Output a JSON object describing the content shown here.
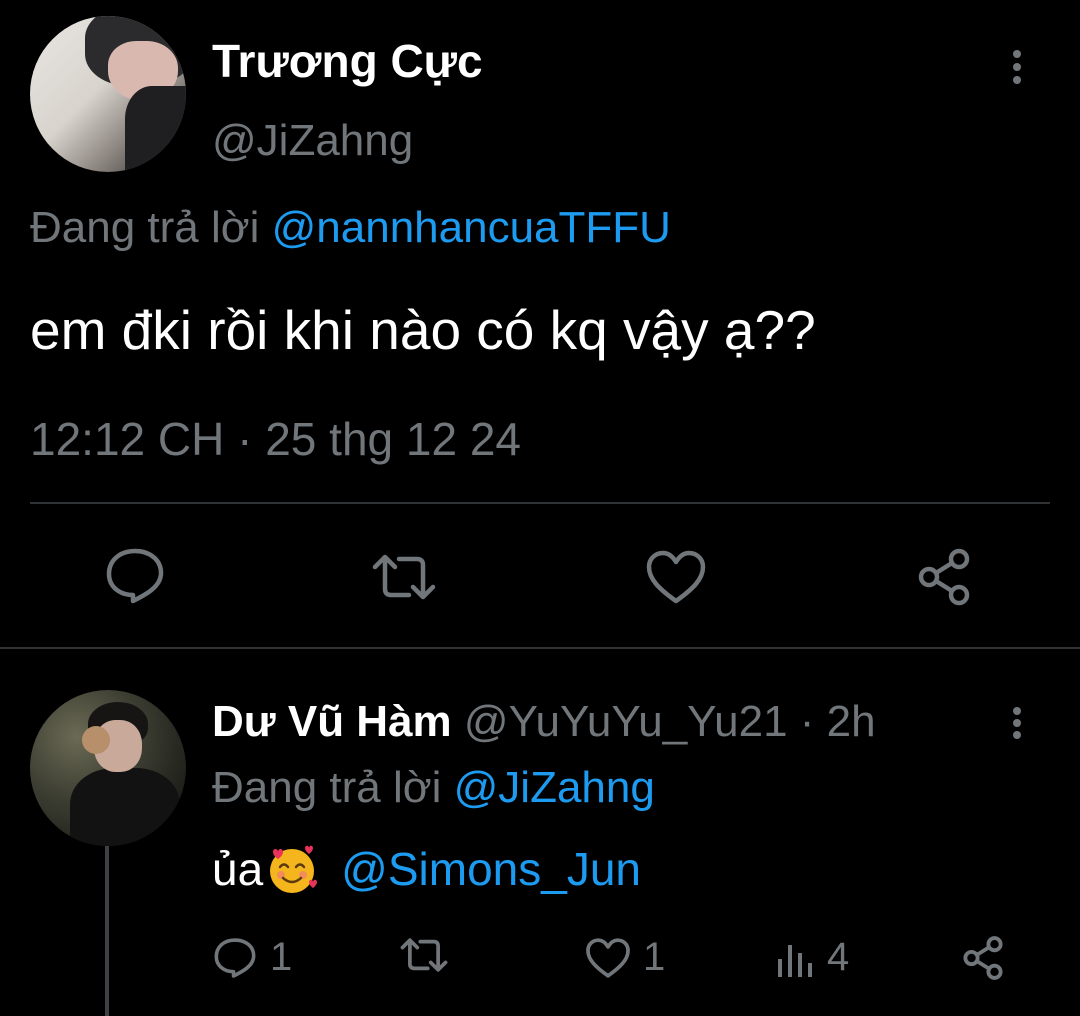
{
  "main_tweet": {
    "display_name": "Trương Cực",
    "handle": "@JiZahng",
    "replying_to_prefix": "Đang trả lời ",
    "replying_to_mention": "@nannhancuaTFFU",
    "text": "em đki rồi khi nào có kq vậy ạ??",
    "timestamp": "12:12 CH · 25 thg 12 24",
    "actions": [
      {
        "name": "reply",
        "icon": "comment-icon"
      },
      {
        "name": "retweet",
        "icon": "retweet-icon"
      },
      {
        "name": "like",
        "icon": "heart-icon"
      },
      {
        "name": "share",
        "icon": "share-icon"
      }
    ]
  },
  "reply_tweet": {
    "display_name": "Dư Vũ Hàm",
    "handle_time": "@YuYuYu_Yu21 · 2h",
    "replying_to_prefix": "Đang trả lời ",
    "replying_to_mention": "@JiZahng",
    "text": "ủa",
    "emoji": "smiling-face-with-hearts",
    "mention": "@Simons_Jun",
    "reply_count": "1",
    "like_count": "1",
    "view_count": "4"
  },
  "colors": {
    "background": "#000000",
    "primary_text": "#ffffff",
    "secondary_text": "#71767b",
    "link": "#1d9bf0",
    "divider": "#2f3336"
  }
}
